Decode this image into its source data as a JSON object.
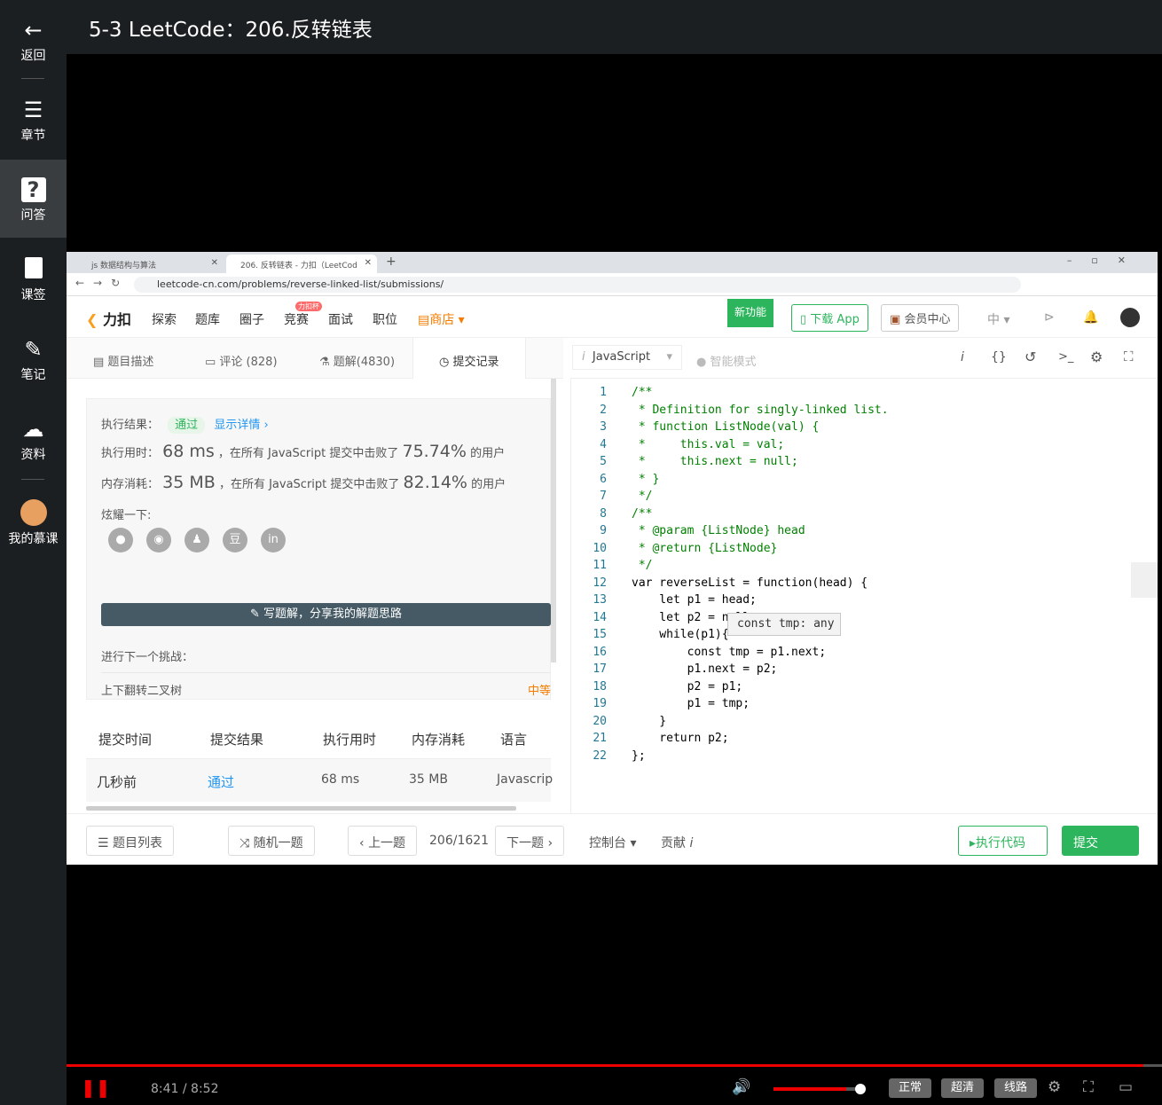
{
  "sidebar": {
    "items": [
      {
        "label": "返回",
        "icon": "arrow-left-icon"
      },
      {
        "label": "章节",
        "icon": "menu-icon"
      },
      {
        "label": "问答",
        "icon": "question-icon"
      },
      {
        "label": "课签",
        "icon": "bookmark-icon"
      },
      {
        "label": "笔记",
        "icon": "pencil-icon"
      },
      {
        "label": "资料",
        "icon": "cloud-download-icon"
      },
      {
        "label": "我的慕课",
        "icon": "avatar-icon"
      }
    ]
  },
  "video": {
    "title": "5-3 LeetCode：206.反转链表",
    "time": "8:41 / 8:52",
    "progress": 0.983,
    "volume": 0.82
  },
  "player_controls": {
    "speed": "正常",
    "quality": "超清",
    "route": "线路"
  },
  "browser": {
    "tab1": "js 数据结构与算法",
    "tab2": "206. 反转链表 - 力扣（LeetCod",
    "url": "leetcode-cn.com/problems/reverse-linked-list/submissions/"
  },
  "lc_nav": {
    "logo": "力扣",
    "items": [
      "探索",
      "题库",
      "圈子",
      "竞赛",
      "面试",
      "职位"
    ],
    "contest_badge": "力扣杯",
    "store": "商店",
    "new_feature": "新功能",
    "download": "下载 App",
    "vip": "会员中心",
    "lang": "中"
  },
  "subtabs": [
    "题目描述",
    "评论 (828)",
    "题解(4830)",
    "提交记录"
  ],
  "result": {
    "label": "执行结果：",
    "status": "通过",
    "detail": "显示详情 ›",
    "time_label": "执行用时：",
    "time_value": "68 ms",
    "time_text": "，在所有 JavaScript 提交中击败了",
    "time_pct": "75.74%",
    "users": "的用户",
    "mem_label": "内存消耗：",
    "mem_value": "35 MB",
    "mem_text": "，在所有 JavaScript 提交中击败了",
    "mem_pct": "82.14%",
    "share_label": "炫耀一下:",
    "write_btn": "写题解，分享我的解题思路",
    "next_label": "进行下一个挑战：",
    "next_problem": "上下翻转二叉树",
    "difficulty": "中等"
  },
  "table": {
    "headers": [
      "提交时间",
      "提交结果",
      "执行用时",
      "内存消耗",
      "语言"
    ],
    "row": [
      "几秒前",
      "通过",
      "68 ms",
      "35 MB",
      "Javascrip"
    ]
  },
  "editor": {
    "language": "JavaScript",
    "mode": "智能模式",
    "tooltip": "const tmp: any",
    "lines": [
      "/**",
      " * Definition for singly-linked list.",
      " * function ListNode(val) {",
      " *     this.val = val;",
      " *     this.next = null;",
      " * }",
      " */",
      "/**",
      " * @param {ListNode} head",
      " * @return {ListNode}",
      " */",
      "var reverseList = function(head) {",
      "    let p1 = head;",
      "    let p2 = null;",
      "    while(p1){",
      "        const tmp = p1.next;",
      "        p1.next = p2;",
      "        p2 = p1;",
      "        p1 = tmp;",
      "    }",
      "    return p2;",
      "};"
    ]
  },
  "bottom": {
    "list": "题目列表",
    "random": "随机一题",
    "prev": "上一题",
    "page": "206/1621",
    "next": "下一题",
    "console": "控制台",
    "contribute": "贡献",
    "run": "执行代码",
    "submit": "提交"
  }
}
